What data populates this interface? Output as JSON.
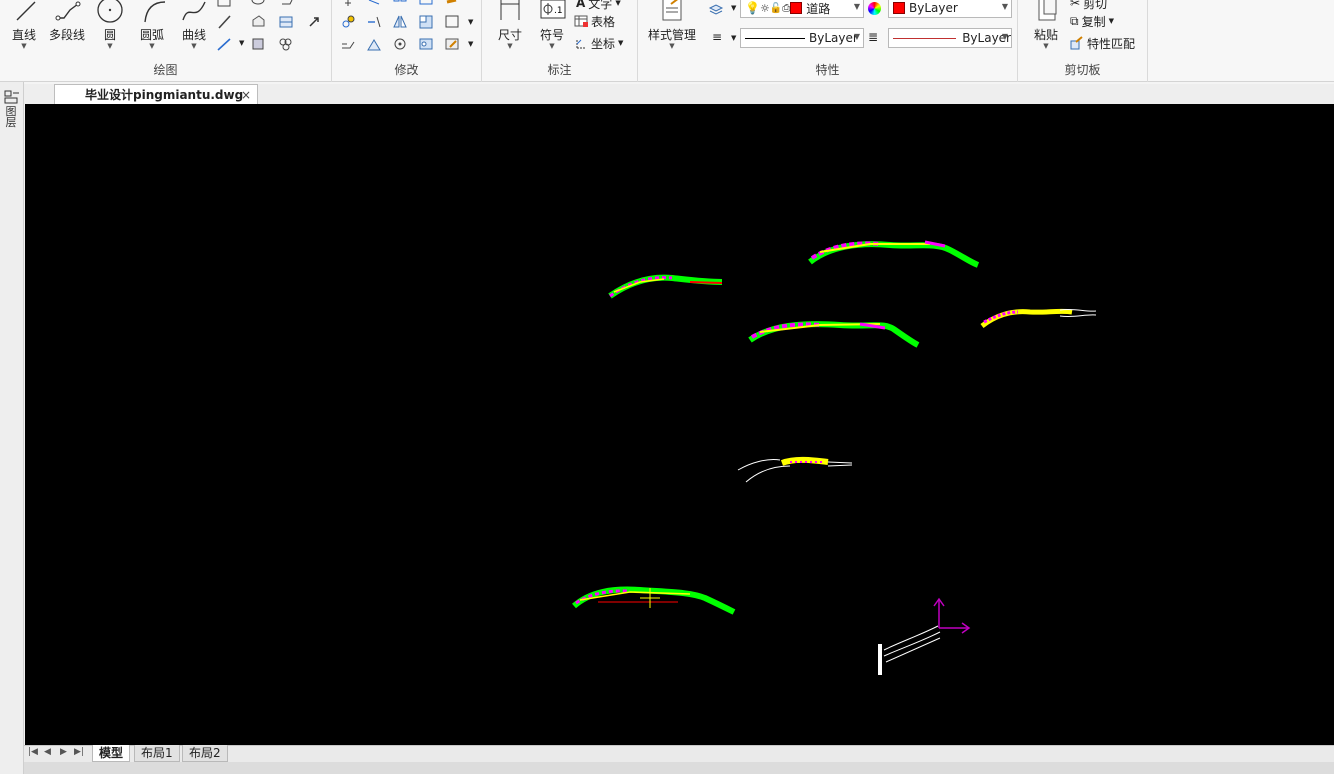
{
  "ribbon": {
    "draw": {
      "title": "绘图",
      "line": "直线",
      "polyline": "多段线",
      "circle": "圆",
      "arc": "圆弧",
      "curve": "曲线"
    },
    "modify": {
      "title": "修改"
    },
    "annotate": {
      "title": "标注",
      "dimension": "尺寸",
      "symbol": "符号",
      "text": "文字",
      "table": "表格",
      "coordinate": "坐标"
    },
    "properties": {
      "title": "特性",
      "style_manager": "样式管理",
      "layer_value": "道路",
      "color_value": "ByLayer",
      "linetype_value": "ByLayer",
      "lineweight_value": "ByLayer"
    },
    "clipboard": {
      "title": "剪切板",
      "paste": "粘贴",
      "cut": "剪切",
      "copy": "复制",
      "match_properties": "特性匹配"
    }
  },
  "left_strip": {
    "label": "图层"
  },
  "document_tab": {
    "label": "毕业设计pingmiantu.dwg",
    "close": "×"
  },
  "layout_tabs": [
    {
      "label": "模型",
      "active": true
    },
    {
      "label": "布局1",
      "active": false
    },
    {
      "label": "布局2",
      "active": false
    }
  ],
  "colors": {
    "canvas": "#000000",
    "green": "#00ff00",
    "magenta": "#ff00ff",
    "yellow": "#ffff00",
    "red": "#ff0000",
    "white": "#ffffff",
    "ucs": "#c000c0"
  }
}
